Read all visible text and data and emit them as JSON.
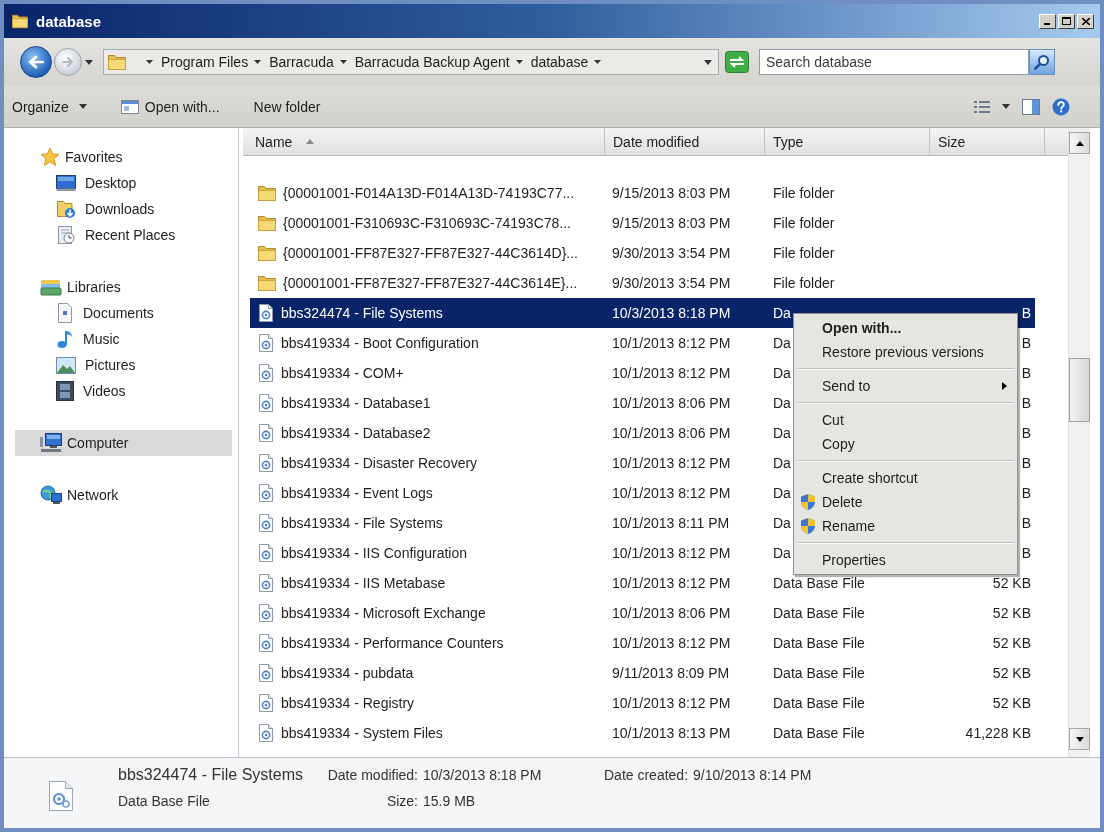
{
  "window": {
    "title": "database"
  },
  "address_bar": {
    "breadcrumbs": [
      "Program Files",
      "Barracuda",
      "Barracuda Backup Agent",
      "database"
    ]
  },
  "search": {
    "placeholder": "Search database"
  },
  "toolbar": {
    "buttons": [
      {
        "label": "Organize",
        "kind": "dropdown"
      },
      {
        "label": "Open with...",
        "kind": "icon"
      },
      {
        "label": "New folder",
        "kind": "plain"
      }
    ]
  },
  "sidebar": {
    "groups": [
      {
        "label": "Favorites",
        "kind": "favorites",
        "selected": false,
        "children": [
          {
            "label": "Desktop",
            "kind": "desktop",
            "selected": false
          },
          {
            "label": "Downloads",
            "kind": "downloads",
            "selected": false
          },
          {
            "label": "Recent Places",
            "kind": "recent",
            "selected": false
          }
        ]
      },
      {
        "label": "Libraries",
        "kind": "libraries",
        "selected": false,
        "children": [
          {
            "label": "Documents",
            "kind": "documents",
            "selected": false
          },
          {
            "label": "Music",
            "kind": "music",
            "selected": false
          },
          {
            "label": "Pictures",
            "kind": "pictures",
            "selected": false
          },
          {
            "label": "Videos",
            "kind": "videos",
            "selected": false
          }
        ]
      },
      {
        "label": "Computer",
        "kind": "computer",
        "selected": true
      },
      {
        "label": "Network",
        "kind": "network",
        "selected": false
      }
    ]
  },
  "file_list": {
    "columns": [
      {
        "label": "Name",
        "sorted": true
      },
      {
        "label": "Date modified",
        "sorted": false
      },
      {
        "label": "Type",
        "sorted": false
      },
      {
        "label": "Size",
        "sorted": false
      }
    ],
    "rows": [
      {
        "name": "{00001001-F014A13D-F014A13D-74193C77...",
        "date_modified": "9/15/2013 8:03 PM",
        "type": "File folder",
        "kind": "folder",
        "selected": false
      },
      {
        "name": "{00001001-F310693C-F310693C-74193C78...",
        "date_modified": "9/15/2013 8:03 PM",
        "type": "File folder",
        "kind": "folder",
        "selected": false
      },
      {
        "name": "{00001001-FF87E327-FF87E327-44C3614D}...",
        "date_modified": "9/30/2013 3:54 PM",
        "type": "File folder",
        "kind": "folder",
        "selected": false
      },
      {
        "name": "{00001001-FF87E327-FF87E327-44C3614E}...",
        "date_modified": "9/30/2013 3:54 PM",
        "type": "File folder",
        "kind": "folder",
        "selected": false
      },
      {
        "name": "bbs324474 - File Systems",
        "date_modified": "10/3/2013 8:18 PM",
        "type": "Da",
        "size": "B",
        "kind": "database",
        "selected": true
      },
      {
        "name": "bbs419334 - Boot Configuration",
        "date_modified": "10/1/2013 8:12 PM",
        "type": "Da",
        "size": "B",
        "kind": "database",
        "selected": false
      },
      {
        "name": "bbs419334 - COM+",
        "date_modified": "10/1/2013 8:12 PM",
        "type": "Da",
        "size": "B",
        "kind": "database",
        "selected": false
      },
      {
        "name": "bbs419334 - Database1",
        "date_modified": "10/1/2013 8:06 PM",
        "type": "Da",
        "size": "B",
        "kind": "database",
        "selected": false
      },
      {
        "name": "bbs419334 - Database2",
        "date_modified": "10/1/2013 8:06 PM",
        "type": "Da",
        "size": "B",
        "kind": "database",
        "selected": false
      },
      {
        "name": "bbs419334 - Disaster Recovery",
        "date_modified": "10/1/2013 8:12 PM",
        "type": "Da",
        "size": "B",
        "kind": "database",
        "selected": false
      },
      {
        "name": "bbs419334 - Event Logs",
        "date_modified": "10/1/2013 8:12 PM",
        "type": "Da",
        "size": "B",
        "kind": "database",
        "selected": false
      },
      {
        "name": "bbs419334 - File Systems",
        "date_modified": "10/1/2013 8:11 PM",
        "type": "Da",
        "size": "B",
        "kind": "database",
        "selected": false
      },
      {
        "name": "bbs419334 - IIS Configuration",
        "date_modified": "10/1/2013 8:12 PM",
        "type": "Da",
        "size": "B",
        "kind": "database",
        "selected": false
      },
      {
        "name": "bbs419334 - IIS Metabase",
        "date_modified": "10/1/2013 8:12 PM",
        "type": "Data Base File",
        "size": "52 KB",
        "kind": "database",
        "selected": false
      },
      {
        "name": "bbs419334 - Microsoft Exchange",
        "date_modified": "10/1/2013 8:06 PM",
        "type": "Data Base File",
        "size": "52 KB",
        "kind": "database",
        "selected": false
      },
      {
        "name": "bbs419334 - Performance Counters",
        "date_modified": "10/1/2013 8:12 PM",
        "type": "Data Base File",
        "size": "52 KB",
        "kind": "database",
        "selected": false
      },
      {
        "name": "bbs419334 - pubdata",
        "date_modified": "9/11/2013 8:09 PM",
        "type": "Data Base File",
        "size": "52 KB",
        "kind": "database",
        "selected": false
      },
      {
        "name": "bbs419334 - Registry",
        "date_modified": "10/1/2013 8:12 PM",
        "type": "Data Base File",
        "size": "52 KB",
        "kind": "database",
        "selected": false
      },
      {
        "name": "bbs419334 - System Files",
        "date_modified": "10/1/2013 8:13 PM",
        "type": "Data Base File",
        "size": "41,228 KB",
        "kind": "database",
        "selected": false
      }
    ]
  },
  "context_menu": {
    "groups": [
      [
        {
          "label": "Open with...",
          "kind": "item",
          "default": true
        },
        {
          "label": "Restore previous versions",
          "kind": "item",
          "default": false
        }
      ],
      [
        {
          "label": "Send to",
          "kind": "submenu",
          "default": false
        }
      ],
      [
        {
          "label": "Cut",
          "kind": "item",
          "default": false
        },
        {
          "label": "Copy",
          "kind": "item",
          "default": false
        }
      ],
      [
        {
          "label": "Create shortcut",
          "kind": "item",
          "default": false
        },
        {
          "label": "Delete",
          "kind": "elevated",
          "default": false
        },
        {
          "label": "Rename",
          "kind": "elevated",
          "default": false
        }
      ],
      [
        {
          "label": "Properties",
          "kind": "item",
          "default": false
        }
      ]
    ]
  },
  "details": {
    "name": "bbs324474 - File Systems",
    "type": "Data Base File",
    "modified": {
      "label": "Date modified:",
      "value": "10/3/2013 8:18 PM"
    },
    "created": {
      "label": "Date created:",
      "value": "9/10/2013 8:14 PM"
    },
    "size": {
      "label": "Size:",
      "value": "15.9 MB"
    }
  }
}
